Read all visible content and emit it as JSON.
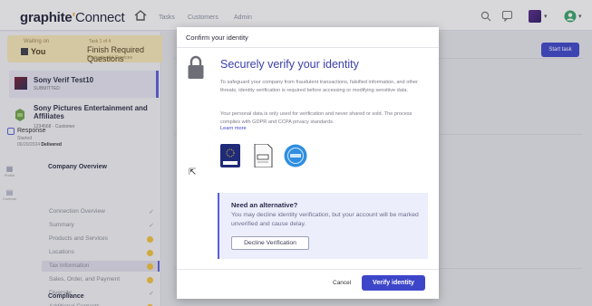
{
  "header": {
    "logo_main": "graphite",
    "logo_sub": "Connect",
    "nav": [
      "Tasks",
      "Customers",
      "Admin"
    ],
    "icons": [
      "home-icon",
      "search-icon",
      "chat-icon",
      "app-switcher-icon",
      "user-icon"
    ]
  },
  "task_banner": {
    "label": "Waiting on",
    "assignee": "You",
    "task_crumb": "Task 1 of 4",
    "task_title": "Finish Required Questions",
    "task_sub": "Products and Services"
  },
  "sidebar": {
    "current": {
      "name": "Sony Verif Test10",
      "sub": "SUBMITTED"
    },
    "vendor": {
      "name": "Sony Pictures Entertainment and Affiliates",
      "sub": "1234568 · Customer"
    },
    "response": {
      "name": "Response",
      "status": "Started",
      "date_prefix": "06/20/2024",
      "date_status": "Delivered"
    },
    "left_nav": [
      {
        "label": "Profile"
      },
      {
        "label": "Controls"
      }
    ],
    "section_title": "Company Overview",
    "section2_title": "Compliance",
    "menu": [
      {
        "label": "Connection Overview",
        "mark": "check"
      },
      {
        "label": "Summary",
        "mark": "check"
      },
      {
        "label": "Products and Services",
        "mark": "dot"
      },
      {
        "label": "Locations",
        "mark": "dot"
      },
      {
        "label": "Tax Information",
        "mark": "dot"
      },
      {
        "label": "Sales, Order, and Payment",
        "mark": "dot"
      },
      {
        "label": "Diversity",
        "mark": "check"
      },
      {
        "label": "Additional Contacts",
        "mark": "dot"
      }
    ],
    "selected_index": 4
  },
  "main": {
    "start_task_label": "Start task"
  },
  "modal": {
    "title": "Confirm your identity",
    "heading": "Securely verify your identity",
    "para1": "To safeguard your company from fraudulent transactions, falsified information, and other threats, identity verification is required before accessing or modifying sensitive data.",
    "para2": "Your personal data is only used for verification and never shared or sold. The process complies with GDPR and CCPA privacy standards.",
    "learn_more": "Learn more",
    "badges": [
      {
        "label": "GDPR",
        "icon": "gdpr-badge-icon"
      },
      {
        "label": "CCPA",
        "icon": "ccpa-badge-icon"
      },
      {
        "label": "SOC",
        "icon": "soc-badge-icon"
      }
    ],
    "alt_title": "Need an alternative?",
    "alt_desc": "You may decline identity verification, but your account will be marked unverified and cause delay.",
    "decline_label": "Decline Verification",
    "cancel_label": "Cancel",
    "verify_label": "Verify identity"
  },
  "colors": {
    "primary": "#3d46c9",
    "banner": "#f6e7b8",
    "alt_bg": "#eceefb",
    "pending_dot": "#f2c13b"
  }
}
